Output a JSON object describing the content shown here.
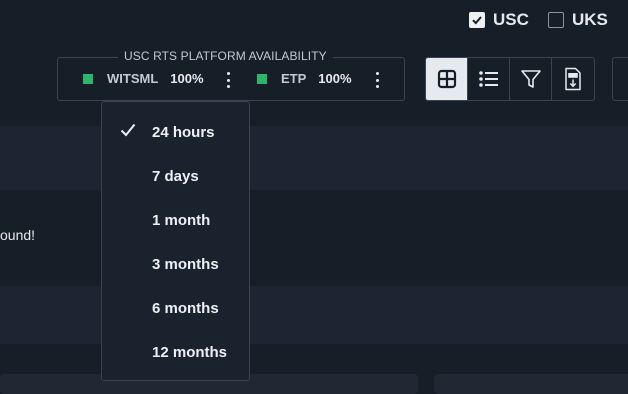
{
  "regions": [
    {
      "label": "USC",
      "checked": true
    },
    {
      "label": "UKS",
      "checked": false
    }
  ],
  "availability": {
    "title": "USC RTS PLATFORM AVAILABILITY",
    "items": [
      {
        "label": "WITSML",
        "value": "100%",
        "status_color": "#2fb56b"
      },
      {
        "label": "ETP",
        "value": "100%",
        "status_color": "#2fb56b"
      }
    ]
  },
  "toolbar": {
    "buttons": [
      {
        "icon": "grid-view-icon",
        "active": true
      },
      {
        "icon": "list-view-icon",
        "active": false
      },
      {
        "icon": "filter-icon",
        "active": false
      },
      {
        "icon": "pdf-download-icon",
        "active": false
      }
    ]
  },
  "time_range_menu": {
    "selected": "24 hours",
    "options": [
      "24 hours",
      "7 days",
      "1 month",
      "3 months",
      "6 months",
      "12 months"
    ]
  },
  "content": {
    "message_fragment": "ound!"
  }
}
